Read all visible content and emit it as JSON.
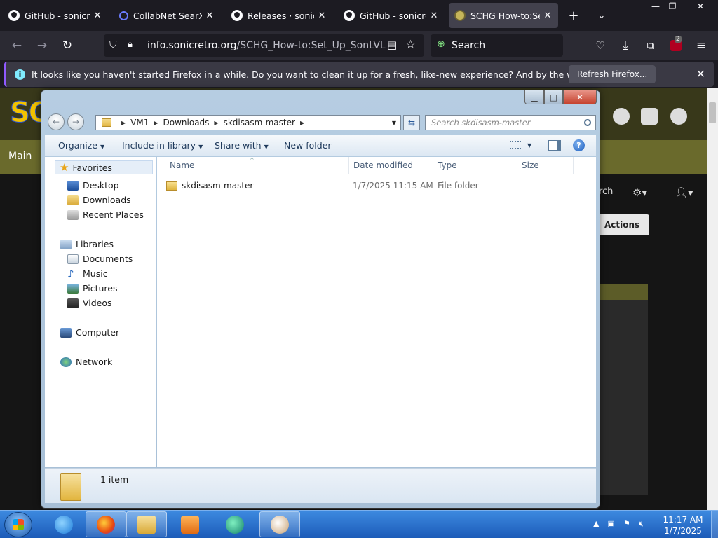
{
  "browser": {
    "tabs": [
      {
        "label": "GitHub - sonicretro",
        "favicon": "github-icon"
      },
      {
        "label": "CollabNet SearXNG",
        "favicon": "search-icon"
      },
      {
        "label": "Releases · sonicretro",
        "favicon": "github-icon"
      },
      {
        "label": "GitHub - sonicretro",
        "favicon": "github-icon"
      },
      {
        "label": "SCHG How-to:Set Up SonLVL",
        "favicon": "sonicretro-icon"
      }
    ],
    "new_tab": "+",
    "url_domain": "info.sonicretro.org",
    "url_path": "/SCHG_How-to:Set_Up_SonLVL",
    "search_placeholder": "Search",
    "extension_badge": "2",
    "notification": {
      "text": "It looks like you haven't started Firefox in a while. Do you want to clean it up for a fresh, like-new experience? And by the way, welcome back!",
      "button": "Refresh Firefox..."
    }
  },
  "website": {
    "logo": "SONIC RETRO",
    "nav_main": "Main",
    "search_label": "arch",
    "actions_label": "Actions"
  },
  "explorer": {
    "breadcrumb": [
      "VM1",
      "Downloads",
      "skdisasm-master"
    ],
    "search_placeholder": "Search skdisasm-master",
    "toolbar": {
      "organize": "Organize",
      "include": "Include in library",
      "share": "Share with",
      "new_folder": "New folder"
    },
    "nav": {
      "favorites": "Favorites",
      "desktop": "Desktop",
      "downloads": "Downloads",
      "recent": "Recent Places",
      "libraries": "Libraries",
      "documents": "Documents",
      "music": "Music",
      "pictures": "Pictures",
      "videos": "Videos",
      "computer": "Computer",
      "network": "Network"
    },
    "columns": {
      "name": "Name",
      "date": "Date modified",
      "type": "Type",
      "size": "Size"
    },
    "files": [
      {
        "name": "skdisasm-master",
        "date": "1/7/2025 11:15 AM",
        "type": "File folder",
        "size": ""
      }
    ],
    "status": "1 item"
  },
  "taskbar": {
    "time": "11:17 AM",
    "date": "1/7/2025"
  }
}
